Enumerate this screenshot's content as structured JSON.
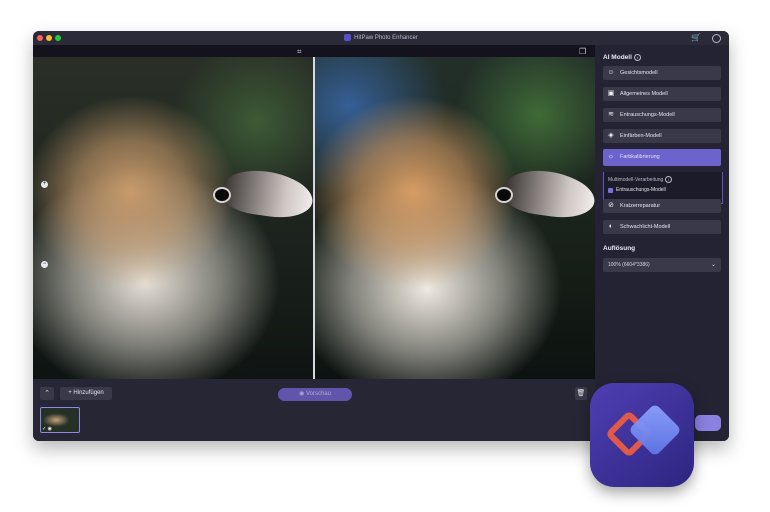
{
  "window": {
    "title": "HitPaw Photo Enhancer"
  },
  "toolbar": {
    "add_label": "Hinzufügen",
    "preview_label": "Vorschau"
  },
  "panel": {
    "ai_model_title": "AI Modell",
    "models": [
      {
        "label": "Gesichtsmodell",
        "icon": "face-icon",
        "active": false
      },
      {
        "label": "Allgemeines Modell",
        "icon": "image-icon",
        "active": false
      },
      {
        "label": "Entrauschungs-Modell",
        "icon": "denoise-icon",
        "active": false
      },
      {
        "label": "Einfärben-Modell",
        "icon": "paint-bucket-icon",
        "active": false
      },
      {
        "label": "Farbkalibrierung",
        "icon": "sun-icon",
        "active": true
      },
      {
        "label": "Kratzerreparatur",
        "icon": "scratch-icon",
        "active": false
      },
      {
        "label": "Schwachlicht-Modell",
        "icon": "contrast-icon",
        "active": false
      }
    ],
    "multimodel": {
      "title": "Multimodell-Verarbeitung",
      "item": "Entrauschungs-Modell"
    },
    "resolution_title": "Auflösung",
    "resolution_value": "100% (6604*3386)"
  },
  "colors": {
    "accent": "#6d63cc",
    "background": "#1e1d2b",
    "panel": "#242333"
  }
}
